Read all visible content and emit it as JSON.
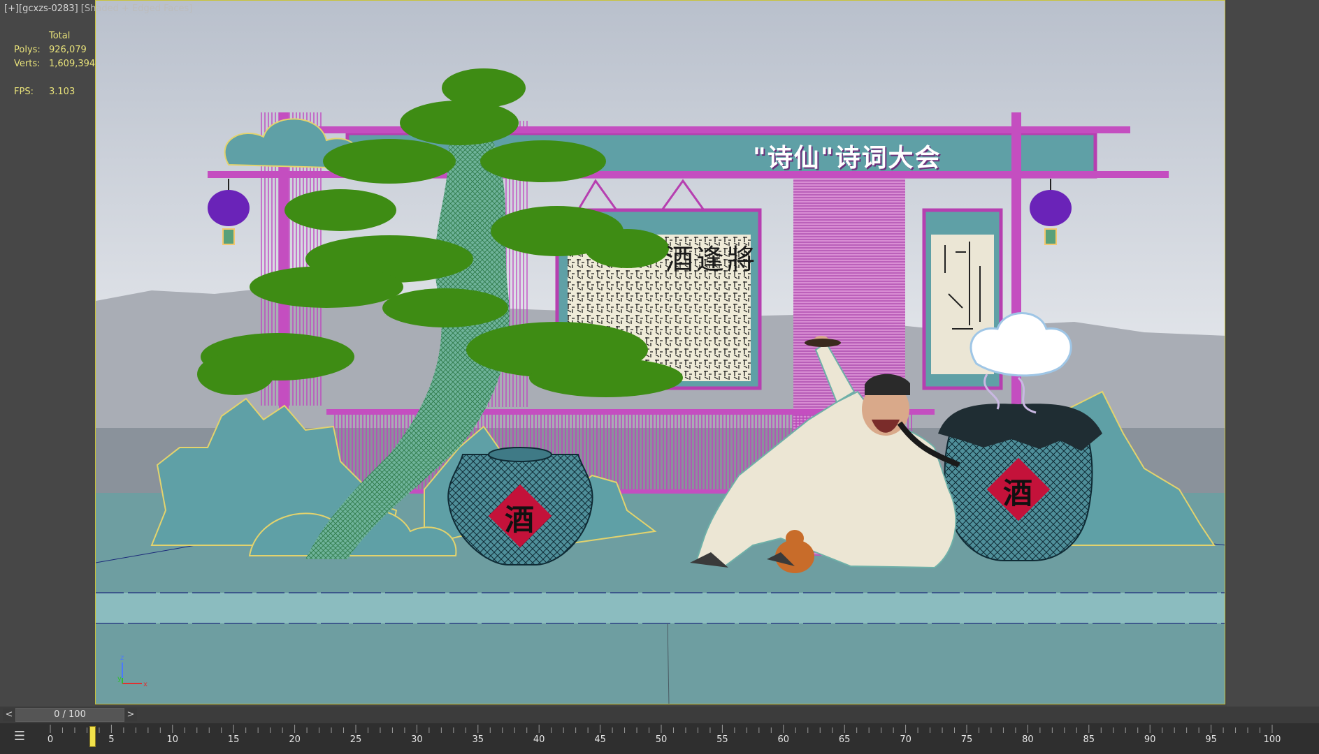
{
  "viewport": {
    "label_prefix": "[+][gcxzs-0283]",
    "label_mode": "[Shaded + Edged Faces]",
    "stats": {
      "total_label": "Total",
      "polys_label": "Polys:",
      "polys_value": "926,079",
      "verts_label": "Verts:",
      "verts_value": "1,609,394",
      "fps_label": "FPS:",
      "fps_value": "3.103"
    },
    "axis": {
      "x": "x",
      "y": "y",
      "z": "z"
    }
  },
  "scene": {
    "banner_title": "\"诗仙\"诗词大会",
    "scroll_heading": "酒逢將",
    "jar_character": "酒",
    "colors": {
      "wireframe": "#b63fb0",
      "teal": "#5fa0a6",
      "tree_green": "#3e8c14",
      "lantern": "#6a23b8",
      "floor": "#6e9ea1",
      "sky": "#d8dce4"
    }
  },
  "timeslider": {
    "prev_label": "<",
    "next_label": ">",
    "position_text": "0 / 100"
  },
  "trackbar": {
    "config_icon": "track-config-icon",
    "tick_labels": [
      "0",
      "5",
      "10",
      "15",
      "20",
      "25",
      "30",
      "35",
      "40",
      "45",
      "50",
      "55",
      "60",
      "65",
      "70",
      "75",
      "80",
      "85",
      "90",
      "95",
      "100"
    ]
  }
}
